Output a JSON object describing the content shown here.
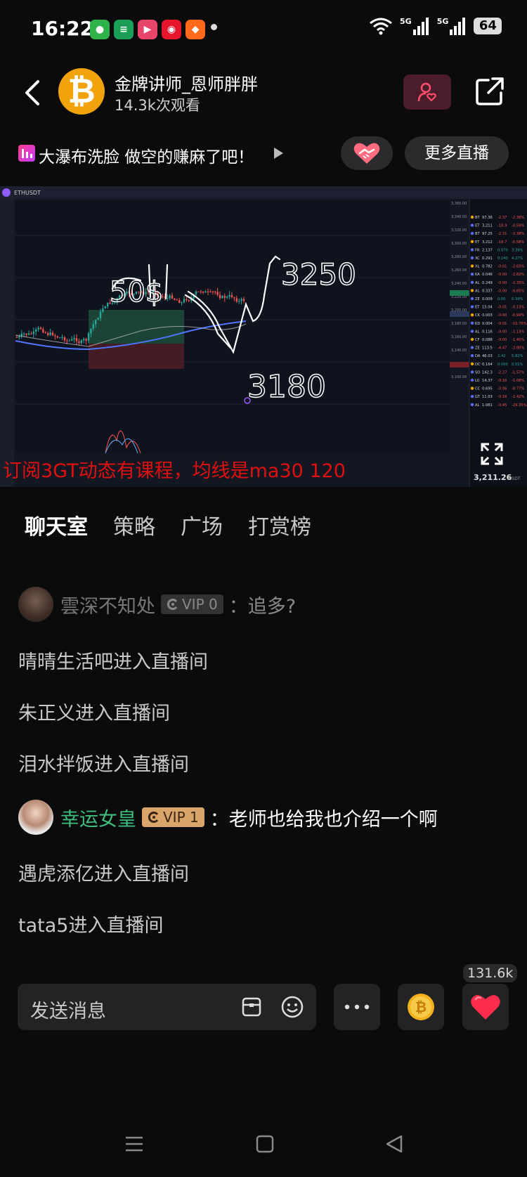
{
  "status": {
    "time": "16:22",
    "signal1": "5G",
    "signal2": "5G",
    "battery": "64"
  },
  "header": {
    "host_name": "金牌讲师_恩师胖胖",
    "viewers": "14.3k次观看"
  },
  "live": {
    "title": "大瀑布洗脸 做空的赚麻了吧！",
    "more_live": "更多直播"
  },
  "video": {
    "symbol": "ETHUSDT",
    "caption": "订阅3GT动态有课程，均线是ma30 120",
    "annotations": {
      "top": "50$",
      "target": "3250",
      "low": "3180"
    },
    "price_now": "3,211.26",
    "price_unit": "USDT",
    "axis_labels": [
      "3,360.00",
      "3,340.00",
      "3,320.00",
      "3,300.00",
      "3,280.00",
      "3,260.00",
      "3,240.00",
      "3,220.00",
      "3,200.00",
      "3,180.00",
      "3,160.00",
      "3,140.00",
      "3,120.00",
      "3,100.00"
    ],
    "watchlist": [
      {
        "sym": "BT",
        "price": "97.36",
        "chg": "-2.37",
        "pct": "-2.38%"
      },
      {
        "sym": "ET",
        "price": "3,211",
        "chg": "-18.9",
        "pct": "-0.59%"
      },
      {
        "sym": "BT",
        "price": "97.25",
        "chg": "-2.31",
        "pct": "-2.38%"
      },
      {
        "sym": "ET",
        "price": "3,212",
        "chg": "-18.7",
        "pct": "-0.58%"
      },
      {
        "sym": "FR",
        "price": "2.137",
        "chg": "0.070",
        "pct": "3.39%"
      },
      {
        "sym": "XC",
        "price": "0.291",
        "chg": "0.140",
        "pct": "4.27%"
      },
      {
        "sym": "XL",
        "price": "0.782",
        "chg": "-0.01",
        "pct": "-2.65%"
      },
      {
        "sym": "KA",
        "price": "0.046",
        "chg": "-0.00",
        "pct": "-2.82%"
      },
      {
        "sym": "AL",
        "price": "0.249",
        "chg": "-0.00",
        "pct": "-2.35%"
      },
      {
        "sym": "AL",
        "price": "0.337",
        "chg": "-0.00",
        "pct": "-0.85%"
      },
      {
        "sym": "ZE",
        "price": "0.009",
        "chg": "0.00",
        "pct": "0.39%"
      },
      {
        "sym": "ET",
        "price": "15.04",
        "chg": "-0.01",
        "pct": "-0.13%"
      },
      {
        "sym": "CK",
        "price": "0.003",
        "chg": "-0.00",
        "pct": "-0.94%"
      },
      {
        "sym": "KD",
        "price": "0.004",
        "chg": "-0.01",
        "pct": "-10.76%"
      },
      {
        "sym": "AL",
        "price": "0.116",
        "chg": "-0.00",
        "pct": "-1.13%"
      },
      {
        "sym": "CF",
        "price": "0.088",
        "chg": "-0.00",
        "pct": "-1.40%"
      },
      {
        "sym": "ZE",
        "price": "113.5",
        "chg": "-4.47",
        "pct": "-3.80%"
      },
      {
        "sym": "DA",
        "price": "46.03",
        "chg": "2.42",
        "pct": "5.82%"
      },
      {
        "sym": "DC",
        "price": "0.164",
        "chg": "0.000",
        "pct": "0.51%"
      },
      {
        "sym": "SO",
        "price": "142.3",
        "chg": "-2.27",
        "pct": "-1.57%"
      },
      {
        "sym": "LU",
        "price": "14.37",
        "chg": "-0.16",
        "pct": "-1.08%"
      },
      {
        "sym": "CC",
        "price": "0.695",
        "chg": "-0.06",
        "pct": "-8.77%"
      },
      {
        "sym": "GT",
        "price": "11.03",
        "chg": "-0.16",
        "pct": "-1.42%"
      },
      {
        "sym": "AL",
        "price": "1.081",
        "chg": "-0.45",
        "pct": "-29.35%"
      }
    ]
  },
  "tabs": [
    {
      "label": "聊天室"
    },
    {
      "label": "策略"
    },
    {
      "label": "广场"
    },
    {
      "label": "打赏榜"
    }
  ],
  "chat": [
    {
      "kind": "msg",
      "user": "雲深不知处",
      "vip": "VIP 0",
      "text": "：追多?"
    },
    {
      "kind": "sys",
      "text": "晴晴生活吧进入直播间"
    },
    {
      "kind": "sys",
      "text": "朱正义进入直播间"
    },
    {
      "kind": "sys",
      "text": "泪水拌饭进入直播间"
    },
    {
      "kind": "msg",
      "user": "幸运女皇",
      "vip": "VIP 1",
      "text": "：老师也给我也介绍一个啊"
    },
    {
      "kind": "sys",
      "text": "遇虎添亿进入直播间"
    },
    {
      "kind": "sys",
      "text": "tata5进入直播间"
    }
  ],
  "bottom": {
    "placeholder": "发送消息",
    "like_count": "131.6k"
  },
  "colors": {
    "accent_bg": "#4b1d2a",
    "vip1": "#d9a56a",
    "vip0": "#9a9a9a",
    "user_green": "#3fbf7f",
    "caption_red": "#e01010"
  }
}
